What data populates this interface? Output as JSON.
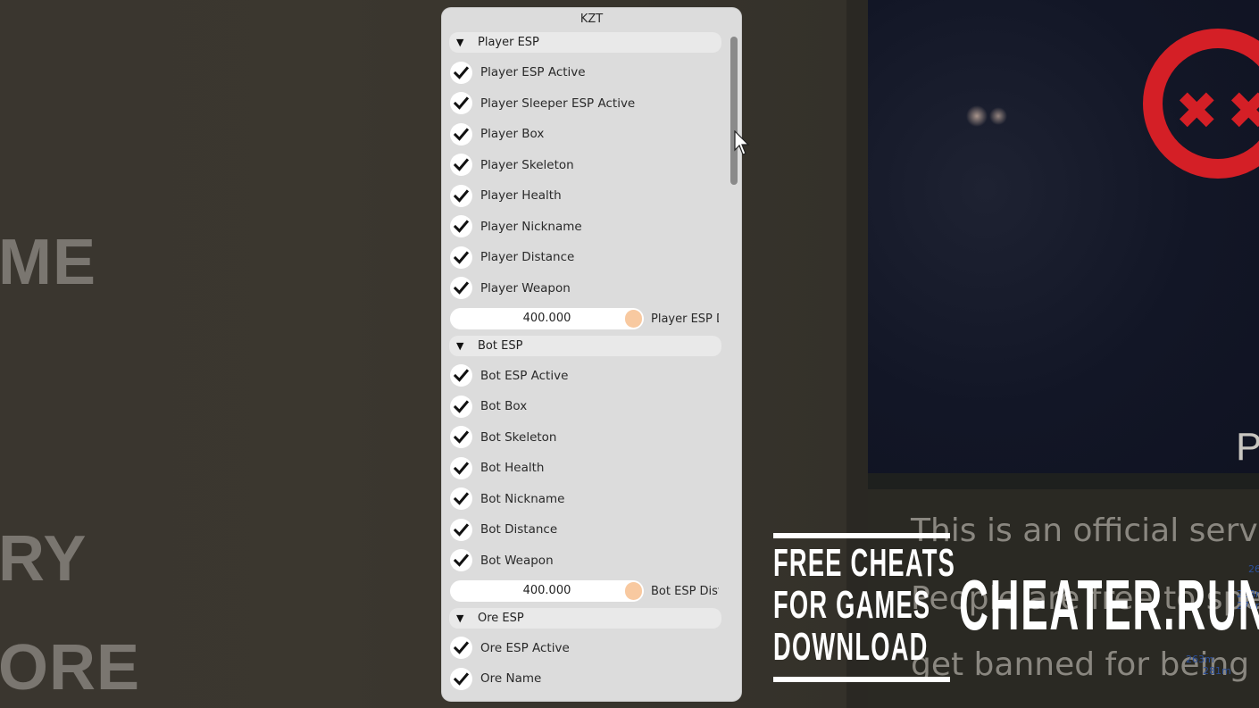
{
  "background": {
    "menu_words": [
      "ME",
      "RY",
      "ORE"
    ],
    "game_letter": "P",
    "server_text_lines": [
      "This is an official serve",
      "People are free to spea",
      "get banned for being ab"
    ],
    "distance_labels": [
      "26",
      "268m",
      "276m",
      "263m",
      "281m"
    ],
    "ban_logo_color": "#d41f26"
  },
  "window": {
    "title": "KZT",
    "accent_color": "#f8c9a0",
    "sections": [
      {
        "title": "Player ESP",
        "expanded": true,
        "checkboxes": [
          {
            "label": "Player ESP Active",
            "checked": true
          },
          {
            "label": "Player Sleeper ESP Active",
            "checked": true
          },
          {
            "label": "Player Box",
            "checked": true
          },
          {
            "label": "Player Skeleton",
            "checked": true
          },
          {
            "label": "Player Health",
            "checked": true
          },
          {
            "label": "Player Nickname",
            "checked": true
          },
          {
            "label": "Player Distance",
            "checked": true
          },
          {
            "label": "Player Weapon",
            "checked": true
          }
        ],
        "slider": {
          "value": "400.000",
          "label": "Player ESP Distance"
        }
      },
      {
        "title": "Bot ESP",
        "expanded": true,
        "checkboxes": [
          {
            "label": "Bot ESP Active",
            "checked": true
          },
          {
            "label": "Bot Box",
            "checked": true
          },
          {
            "label": "Bot Skeleton",
            "checked": true
          },
          {
            "label": "Bot Health",
            "checked": true
          },
          {
            "label": "Bot Nickname",
            "checked": true
          },
          {
            "label": "Bot Distance",
            "checked": true
          },
          {
            "label": "Bot Weapon",
            "checked": true
          }
        ],
        "slider": {
          "value": "400.000",
          "label": "Bot ESP Distance"
        }
      },
      {
        "title": "Ore ESP",
        "expanded": true,
        "checkboxes": [
          {
            "label": "Ore ESP Active",
            "checked": true
          },
          {
            "label": "Ore Name",
            "checked": true
          }
        ]
      }
    ]
  },
  "watermark": {
    "lines": [
      "FREE CHEATS",
      "FOR GAMES",
      "DOWNLOAD"
    ],
    "site": "CHEATER.RUN"
  }
}
